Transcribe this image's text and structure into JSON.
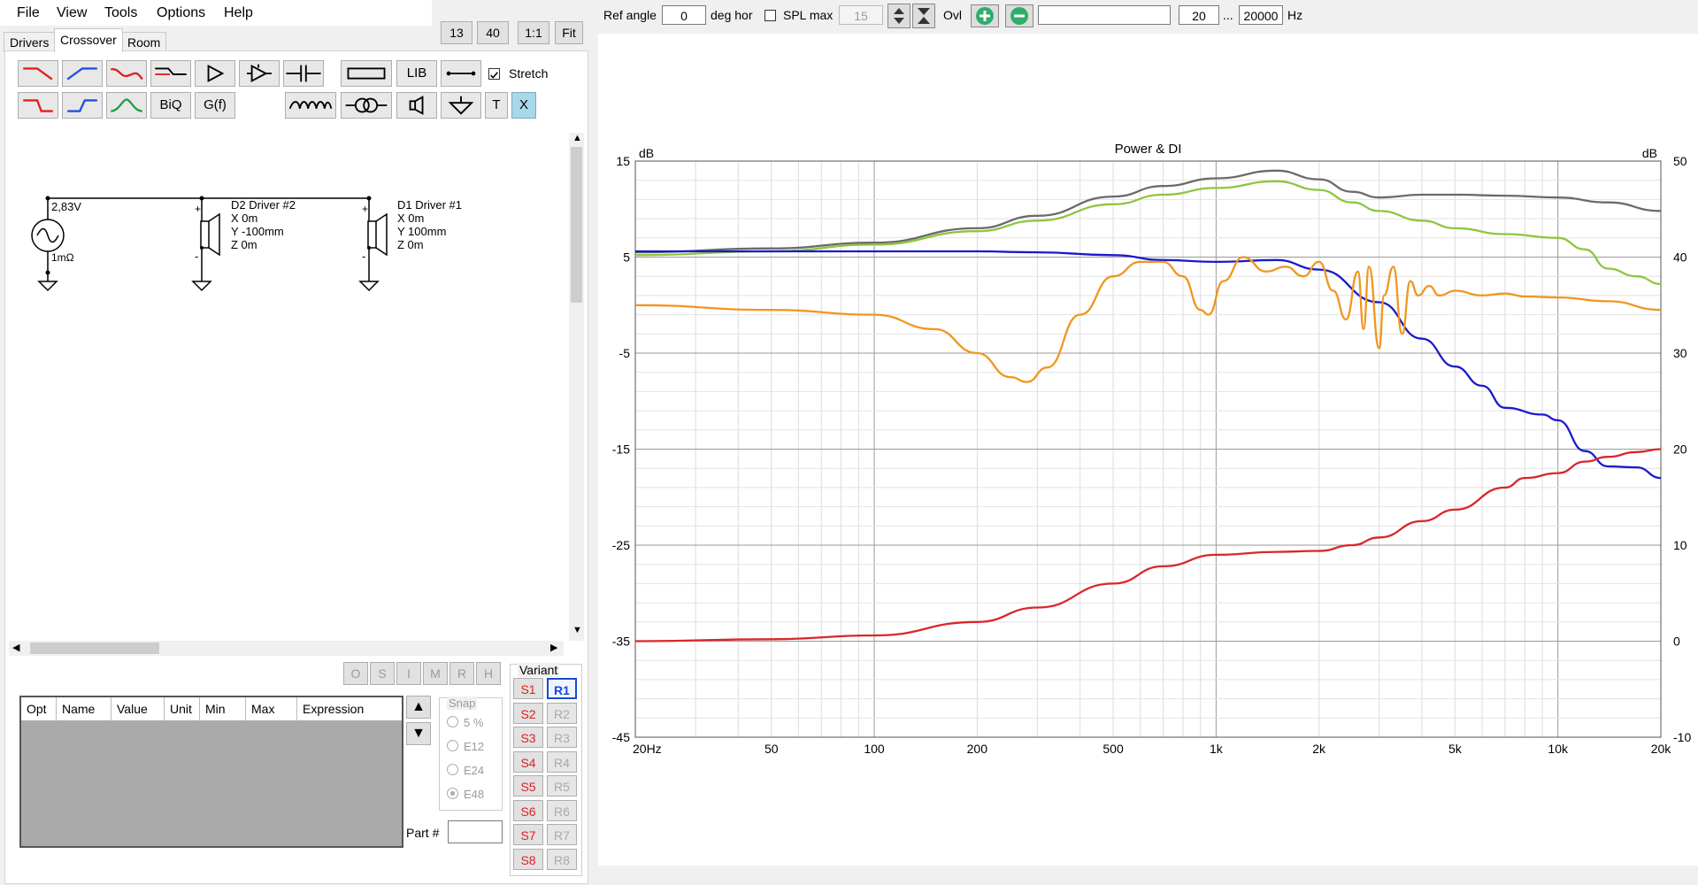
{
  "menu": [
    "File",
    "View",
    "Tools",
    "Options",
    "Help"
  ],
  "tabs": {
    "drivers": "Drivers",
    "crossover": "Crossover",
    "room": "Room"
  },
  "zoom_buttons": {
    "b13": "13",
    "b40": "40",
    "one": "1:1",
    "fit": "Fit"
  },
  "toolbar": {
    "lib": "LIB",
    "biq": "BiQ",
    "gf": "G(f)",
    "t": "T",
    "x": "X",
    "stretch_label": "Stretch",
    "stretch_checked": true
  },
  "schematic": {
    "source_voltage": "2,83V",
    "source_resistance": "1mΩ",
    "driver2": {
      "name": "D2 Driver #2",
      "x": "X 0m",
      "y": "Y -100mm",
      "z": "Z 0m"
    },
    "driver1": {
      "name": "D1 Driver #1",
      "x": "X 0m",
      "y": "Y 100mm",
      "z": "Z 0m"
    }
  },
  "state_buttons": [
    "O",
    "S",
    "I",
    "M",
    "R",
    "H"
  ],
  "table": {
    "columns": [
      "Opt",
      "Name",
      "Value",
      "Unit",
      "Min",
      "Max",
      "Expression"
    ]
  },
  "snap": {
    "label": "Snap",
    "options": [
      "5 %",
      "E12",
      "E24",
      "E48"
    ],
    "selected": "E48"
  },
  "part_label": "Part #",
  "variant": {
    "label": "Variant",
    "s": [
      "S1",
      "S2",
      "S3",
      "S4",
      "S5",
      "S6",
      "S7",
      "S8"
    ],
    "r": [
      "R1",
      "R2",
      "R3",
      "R4",
      "R5",
      "R6",
      "R7",
      "R8"
    ],
    "active_r": "R1"
  },
  "topbar": {
    "ref_angle_label": "Ref angle",
    "ref_angle_value": "0",
    "deg_hor": "deg hor",
    "spl_max_label": "SPL max",
    "spl_max_value": "15",
    "ovl": "Ovl",
    "freq_min": "20",
    "freq_sep": "...",
    "freq_max": "20000",
    "hz": "Hz"
  },
  "chart_data": {
    "type": "line",
    "title": "Power & DI",
    "xscale": "log",
    "xlim": [
      20,
      20000
    ],
    "x_ticks": [
      "20Hz",
      "50",
      "100",
      "200",
      "500",
      "1k",
      "2k",
      "5k",
      "10k",
      "20k"
    ],
    "x_tick_values": [
      20,
      50,
      100,
      200,
      500,
      1000,
      2000,
      5000,
      10000,
      20000
    ],
    "y_left": {
      "label": "dB",
      "lim": [
        -45,
        15
      ],
      "ticks": [
        "15",
        "5",
        "-5",
        "-15",
        "-25",
        "-35",
        "-45"
      ]
    },
    "y_right": {
      "label": "dB",
      "lim": [
        -10,
        50
      ],
      "ticks": [
        "50",
        "40",
        "30",
        "20",
        "10",
        "0",
        "-10"
      ]
    },
    "grid": true,
    "series": [
      {
        "color": "#6a6a6a",
        "axis": "left",
        "x": [
          20,
          50,
          100,
          200,
          300,
          500,
          700,
          1000,
          1500,
          2000,
          2500,
          3000,
          4000,
          5000,
          7000,
          10000,
          14000,
          20000
        ],
        "y": [
          5.5,
          5.9,
          6.5,
          8.0,
          9.3,
          11.3,
          12.4,
          13.2,
          14.0,
          13.1,
          11.8,
          11.2,
          11.5,
          11.5,
          11.4,
          11.2,
          10.7,
          9.8
        ]
      },
      {
        "color": "#8dc63f",
        "axis": "left",
        "x": [
          20,
          50,
          100,
          200,
          300,
          500,
          700,
          1000,
          1500,
          2000,
          2500,
          3000,
          4000,
          5000,
          7000,
          10000,
          12000,
          14000,
          17000,
          20000
        ],
        "y": [
          5.2,
          5.6,
          6.3,
          7.7,
          8.8,
          10.5,
          11.5,
          12.2,
          12.9,
          12.0,
          10.7,
          9.8,
          8.8,
          8.0,
          7.4,
          7.0,
          5.8,
          3.8,
          3.0,
          2.2
        ]
      },
      {
        "color": "#1a1acc",
        "axis": "right",
        "x": [
          20,
          50,
          100,
          200,
          300,
          500,
          700,
          1000,
          1500,
          2000,
          3000,
          4000,
          5000,
          6000,
          7000,
          9000,
          10000,
          12000,
          14000,
          17000,
          20000
        ],
        "y": [
          40.6,
          40.6,
          40.6,
          40.6,
          40.5,
          40.2,
          39.7,
          39.5,
          39.7,
          38.7,
          35.3,
          31.5,
          28.6,
          26.6,
          24.3,
          23.6,
          23.0,
          19.8,
          18.2,
          18.1,
          17.0
        ]
      },
      {
        "color": "#f0961e",
        "axis": "left",
        "x": [
          20,
          50,
          100,
          150,
          200,
          250,
          280,
          320,
          400,
          500,
          600,
          700,
          800,
          900,
          950,
          1050,
          1200,
          1400,
          1600,
          1800,
          2000,
          2200,
          2400,
          2600,
          2700,
          2800,
          3000,
          3100,
          3300,
          3500,
          3700,
          3900,
          4200,
          4500,
          5000,
          6000,
          7000,
          8000,
          10000,
          14000,
          20000
        ],
        "y": [
          0.0,
          -0.5,
          -1.0,
          -2.5,
          -5.0,
          -7.5,
          -8.0,
          -6.5,
          -1.0,
          3.0,
          4.5,
          4.5,
          3.0,
          -0.5,
          -1.0,
          2.5,
          5.0,
          3.5,
          4.0,
          3.0,
          4.5,
          1.5,
          -1.5,
          3.5,
          -2.5,
          4.0,
          -4.5,
          1.0,
          4.0,
          -3.0,
          2.5,
          1.0,
          2.0,
          1.0,
          1.5,
          1.0,
          1.2,
          0.9,
          0.8,
          0.4,
          -0.5
        ]
      },
      {
        "color": "#d9262b",
        "axis": "left",
        "x": [
          20,
          50,
          100,
          200,
          300,
          500,
          700,
          1000,
          1500,
          2000,
          2500,
          3000,
          4000,
          5000,
          7000,
          8000,
          10000,
          12000,
          14000,
          17000,
          20000
        ],
        "y": [
          -35.0,
          -34.8,
          -34.4,
          -33.0,
          -31.5,
          -29.0,
          -27.2,
          -26.0,
          -25.7,
          -25.6,
          -25.0,
          -24.2,
          -22.5,
          -21.3,
          -19.0,
          -18.0,
          -17.5,
          -16.3,
          -15.8,
          -15.3,
          -15.0
        ]
      }
    ]
  }
}
